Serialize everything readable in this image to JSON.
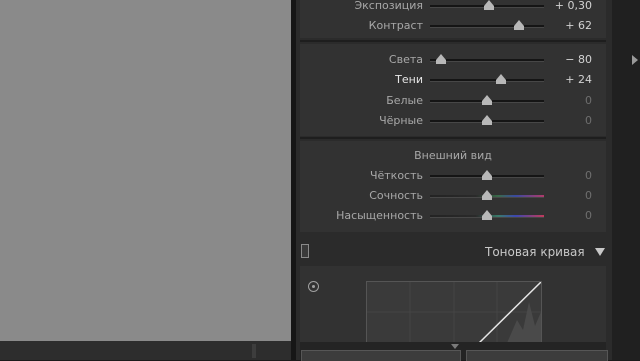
{
  "basic": {
    "sliders_top": [
      {
        "label": "Экспозиция",
        "value": "+ 0,30",
        "pos": 0.52,
        "active": false
      },
      {
        "label": "Контраст",
        "value": "+ 62",
        "pos": 0.78,
        "active": false
      }
    ],
    "sliders_tone": [
      {
        "label": "Света",
        "value": "− 80",
        "pos": 0.1,
        "active": false
      },
      {
        "label": "Тени",
        "value": "+ 24",
        "pos": 0.62,
        "active": true
      },
      {
        "label": "Белые",
        "value": "0",
        "pos": 0.5,
        "active": false
      },
      {
        "label": "Чёрные",
        "value": "0",
        "pos": 0.5,
        "active": false
      }
    ]
  },
  "presence": {
    "title": "Внешний вид",
    "sliders": [
      {
        "label": "Чёткость",
        "value": "0",
        "pos": 0.5,
        "track": "plain"
      },
      {
        "label": "Сочность",
        "value": "0",
        "pos": 0.5,
        "track": "vib"
      },
      {
        "label": "Насыщенность",
        "value": "0",
        "pos": 0.5,
        "track": "sat"
      }
    ]
  },
  "tone_curve": {
    "title": "Тоновая кривая"
  },
  "icons": {
    "collapse": "triangle-down-icon",
    "target": "target-adjust-icon",
    "panel_toggle": "panel-switch-icon",
    "edge_arrow": "triangle-right-icon"
  },
  "colors": {
    "canvas": "#8a8a8a",
    "panel": "#2b2b2b",
    "section": "#323232",
    "text": "#a8a8a8",
    "value": "#d2d2d2"
  }
}
